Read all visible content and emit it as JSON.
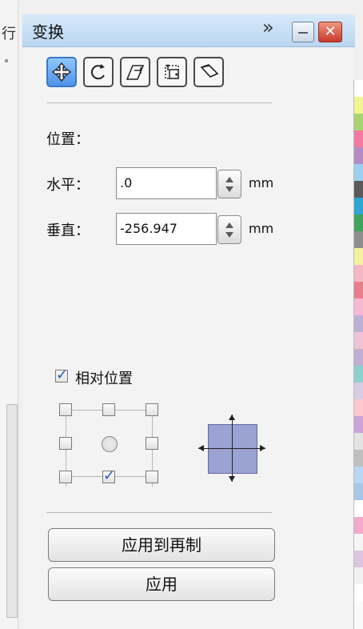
{
  "window": {
    "title": "变换",
    "expand_glyph": "»",
    "close_glyph": "✕"
  },
  "left_panel": {
    "fragment": "行"
  },
  "toolbar": {
    "buttons": [
      {
        "name": "position-icon",
        "active": true
      },
      {
        "name": "rotate-icon",
        "active": false
      },
      {
        "name": "scale-mirror-icon",
        "active": false
      },
      {
        "name": "size-icon",
        "active": false
      },
      {
        "name": "skew-icon",
        "active": false
      }
    ]
  },
  "position": {
    "section_title": "位置：",
    "horizontal": {
      "label": "水平：",
      "value": ".0",
      "unit": "mm"
    },
    "vertical": {
      "label": "垂直：",
      "value": "-256.947",
      "unit": "mm"
    }
  },
  "relative": {
    "label": "相对位置",
    "checked": true,
    "grid_selected": "bottom-center"
  },
  "actions": {
    "apply_copy": "应用到再制",
    "apply": "应用"
  },
  "palette": [
    "#ffffff",
    "#f2f58f",
    "#a8d46f",
    "#f47aa2",
    "#b38cc3",
    "#9ad0ee",
    "#5a5a5a",
    "#2da6d6",
    "#3ea35b",
    "#8e8e8e",
    "#f4f29a",
    "#f7b6c6",
    "#e77d8d",
    "#f6b8d3",
    "#bdb0d5",
    "#f0c3d4",
    "#c0afd3",
    "#8dd1cf",
    "#d6cde2",
    "#ffc7cd",
    "#c9a4d8",
    "#e3e3e3",
    "#bfbfbf",
    "#b9d7f2",
    "#a7c7e7",
    "#ffffff",
    "#f3a9cc",
    "#f5f5f5",
    "#dcc6df",
    "#f2f2f2",
    "#ffffff"
  ]
}
